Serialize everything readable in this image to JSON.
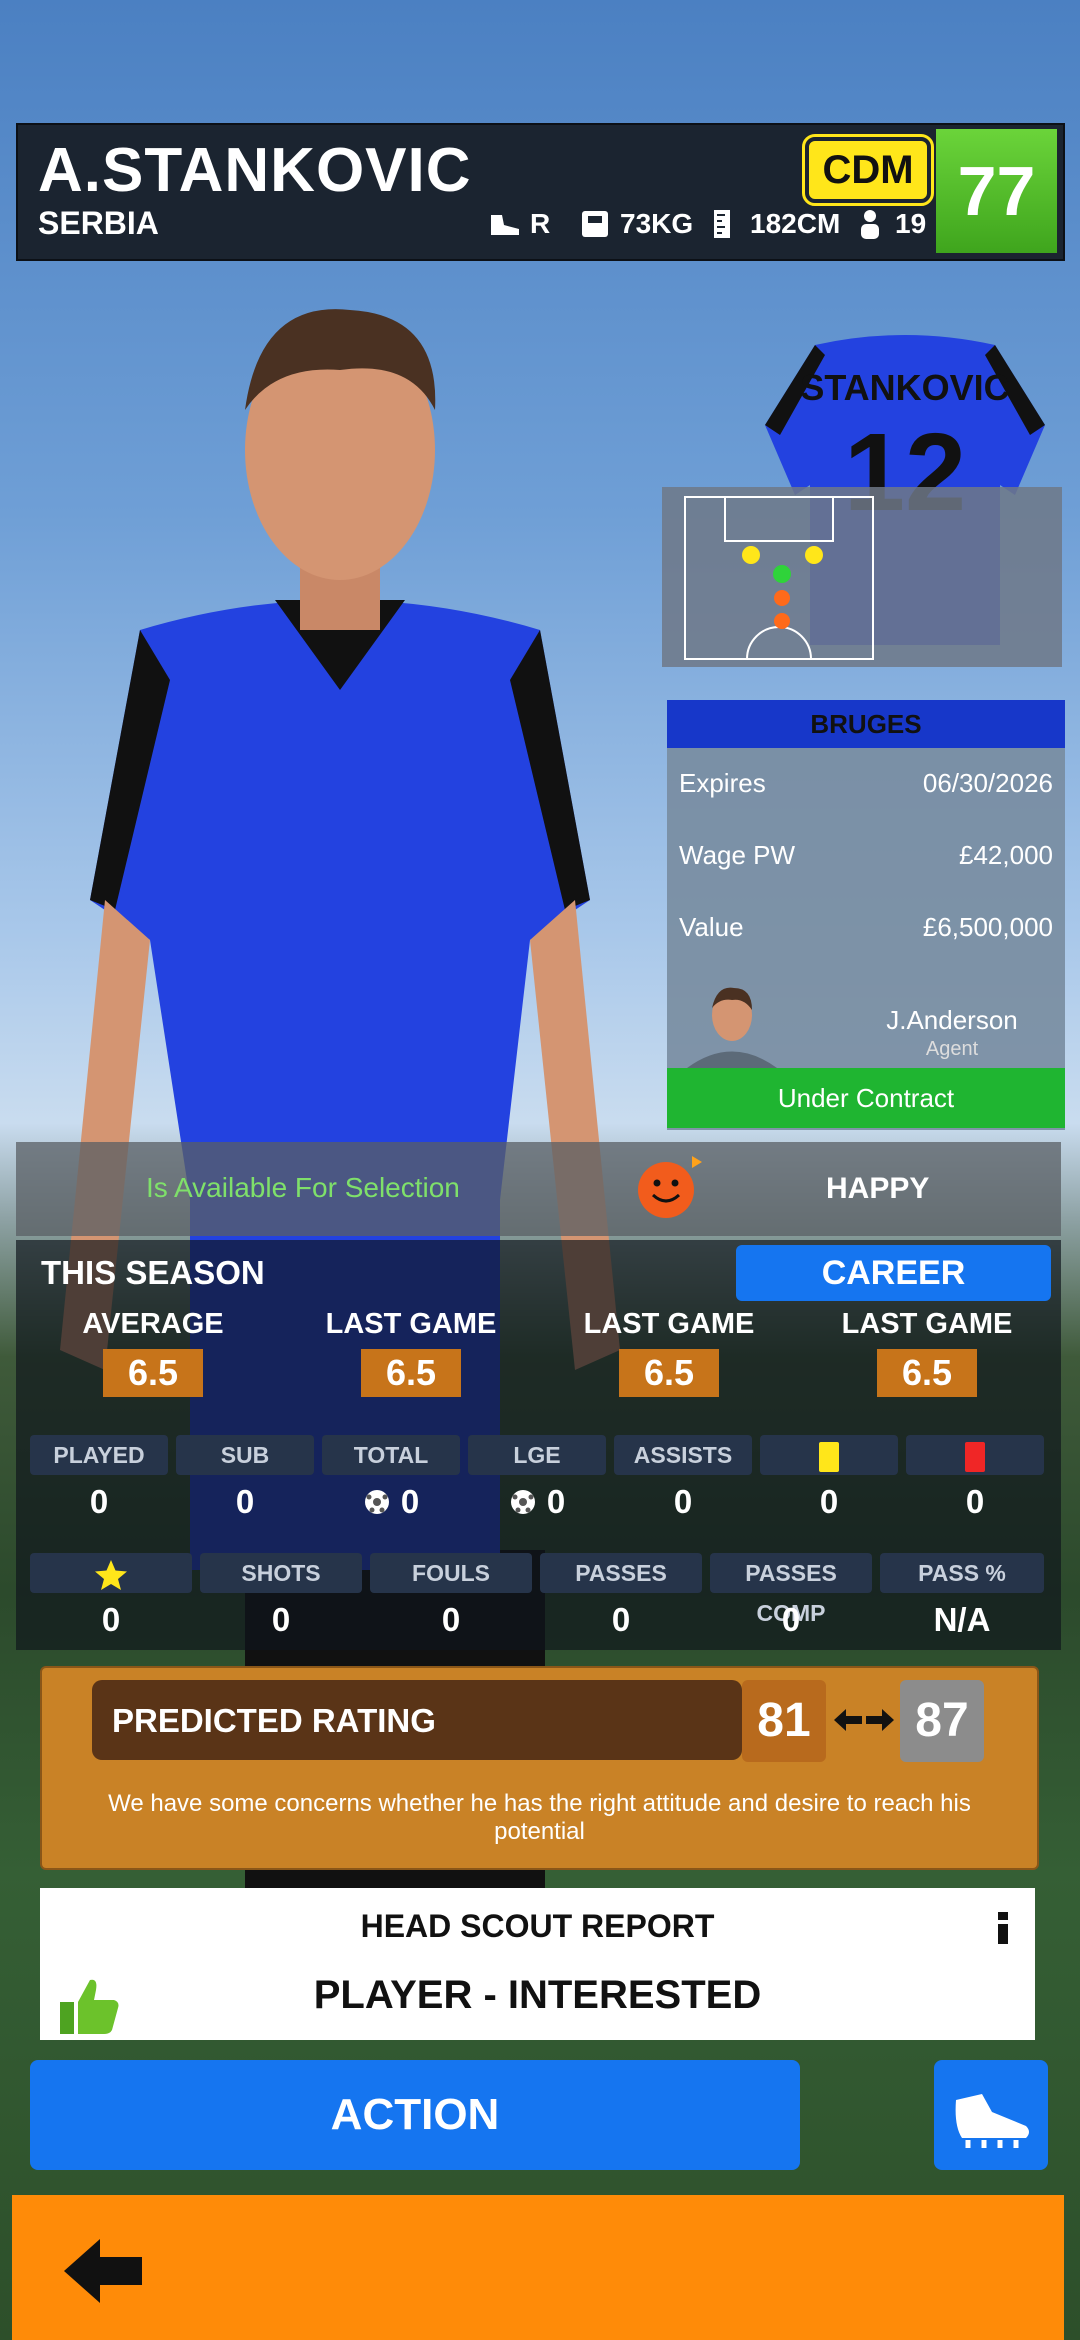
{
  "player": {
    "name": "A.STANKOVIC",
    "nation": "SERBIA",
    "foot": "R",
    "weight": "73KG",
    "height": "182CM",
    "age": "19",
    "position": "CDM",
    "overall": "77",
    "shirt_name": "STANKOVIC",
    "shirt_number": "12"
  },
  "contract": {
    "club": "BRUGES",
    "expires_label": "Expires",
    "expires_value": "06/30/2026",
    "wage_label": "Wage PW",
    "wage_value": "£42,000",
    "value_label": "Value",
    "value_value": "£6,500,000",
    "agent_name": "J.Anderson",
    "agent_role": "Agent",
    "status": "Under Contract"
  },
  "availability": {
    "text": "Is Available For Selection",
    "mood": "HAPPY"
  },
  "season": {
    "title": "THIS SEASON",
    "career_button": "CAREER",
    "ratings": [
      {
        "label": "AVERAGE",
        "value": "6.5"
      },
      {
        "label": "LAST GAME",
        "value": "6.5"
      },
      {
        "label": "LAST GAME",
        "value": "6.5"
      },
      {
        "label": "LAST GAME",
        "value": "6.5"
      }
    ],
    "row1": [
      {
        "label": "PLAYED",
        "value": "0"
      },
      {
        "label": "SUB",
        "value": "0"
      },
      {
        "label": "TOTAL",
        "value": "0"
      },
      {
        "label": "LGE",
        "value": "0"
      },
      {
        "label": "ASSISTS",
        "value": "0"
      },
      {
        "label": "",
        "value": "0"
      },
      {
        "label": "",
        "value": "0"
      }
    ],
    "row2": [
      {
        "label": "",
        "value": "0"
      },
      {
        "label": "SHOTS",
        "value": "0"
      },
      {
        "label": "FOULS",
        "value": "0"
      },
      {
        "label": "PASSES",
        "value": "0"
      },
      {
        "label": "PASSES COMP",
        "value": "0"
      },
      {
        "label": "PASS %",
        "value": "N/A"
      }
    ]
  },
  "predicted": {
    "title": "PREDICTED RATING",
    "low": "81",
    "high": "87",
    "note": "We have some concerns whether he has the right attitude and desire to reach his potential"
  },
  "scout": {
    "title": "HEAD SCOUT REPORT",
    "verdict": "PLAYER - INTERESTED"
  },
  "buttons": {
    "action": "ACTION"
  },
  "colors": {
    "accent_blue": "#1575f0",
    "orange": "#ff8b08",
    "green": "#1fb531",
    "position_yellow": "#ffe61a"
  }
}
